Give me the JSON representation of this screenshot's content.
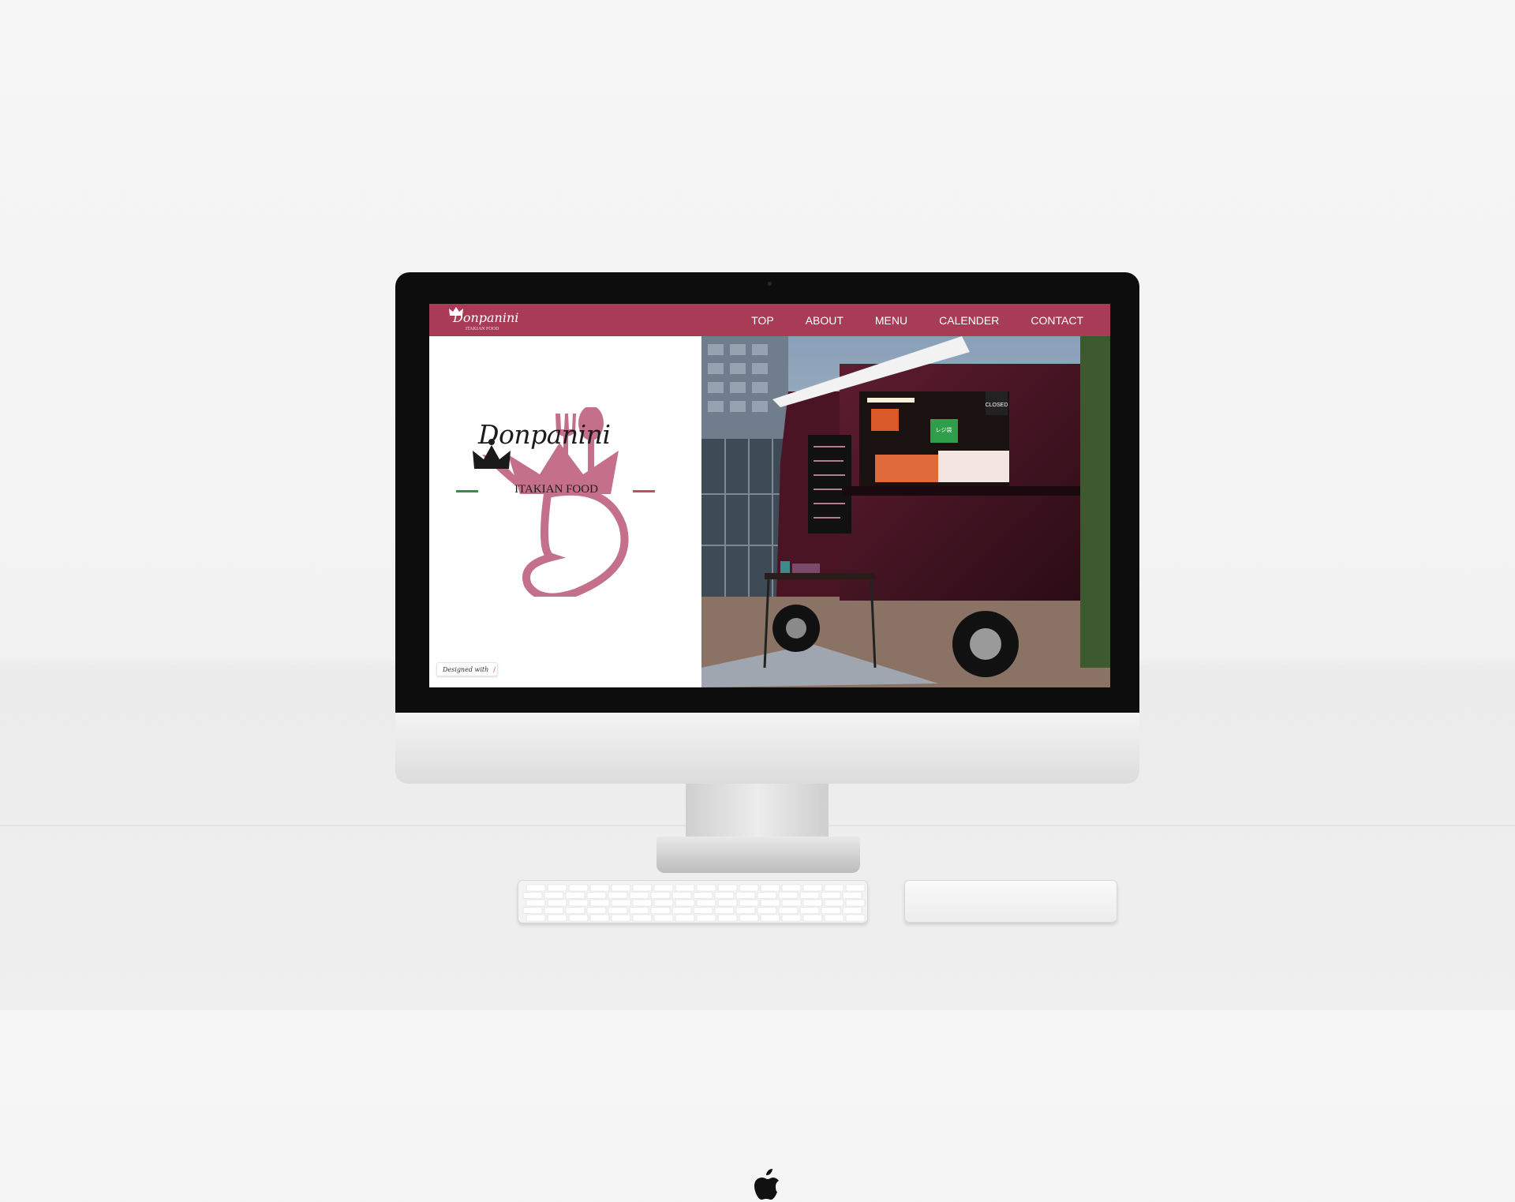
{
  "site": {
    "brand": "Donpanini",
    "tagline": "ITAKIAN FOOD",
    "nav": [
      {
        "label": "TOP"
      },
      {
        "label": "ABOUT"
      },
      {
        "label": "MENU"
      },
      {
        "label": "CALENDER"
      },
      {
        "label": "CONTACT"
      }
    ],
    "badge": "Designed with",
    "colors": {
      "accent": "#a83c56",
      "logo_pink": "#c4708a",
      "tag_green": "#3a8a4a",
      "tag_red": "#c84a62"
    }
  },
  "photo": {
    "signs": {
      "closed": "CLOSED",
      "register": "レジ袋"
    }
  },
  "device": {
    "icons": [
      "apple-logo-icon"
    ]
  }
}
